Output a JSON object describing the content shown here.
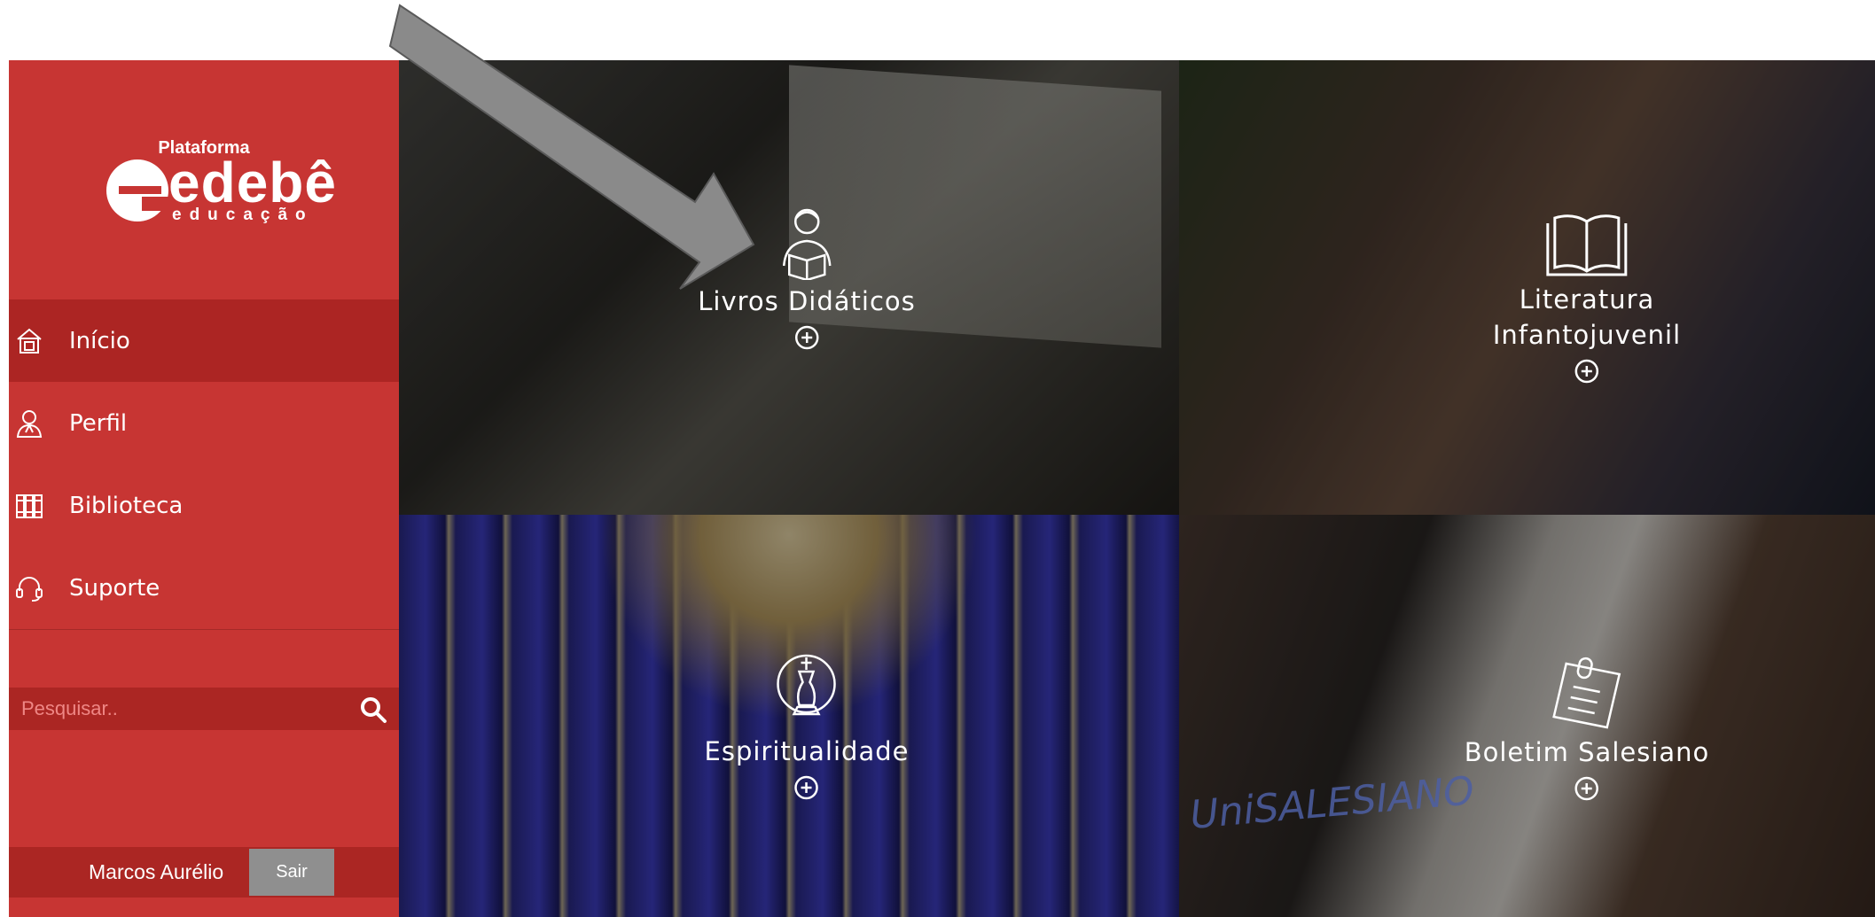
{
  "sidebar": {
    "logo": {
      "top_text": "Plataforma",
      "wordmark": "edebê",
      "tagline": "educação"
    },
    "menu": [
      {
        "label": "Início",
        "icon": "home-icon",
        "active": true
      },
      {
        "label": "Perfil",
        "icon": "user-icon",
        "active": false
      },
      {
        "label": "Biblioteca",
        "icon": "books-icon",
        "active": false
      },
      {
        "label": "Suporte",
        "icon": "headset-icon",
        "active": false
      }
    ],
    "search": {
      "placeholder": "Pesquisar..",
      "icon": "search-icon"
    },
    "footer": {
      "user_name": "Marcos Aurélio",
      "logout_label": "Sair"
    }
  },
  "tiles": [
    {
      "title": "Livros Didáticos",
      "icon": "reading-student-icon"
    },
    {
      "title_line1": "Literatura",
      "title_line2": "Infantojuvenil",
      "icon": "open-book-icon"
    },
    {
      "title": "Espiritualidade",
      "icon": "cross-icon"
    },
    {
      "title": "Boletim Salesiano",
      "icon": "newsletter-icon",
      "photo_text": "UniSALESIANO"
    }
  ],
  "colors": {
    "sidebar": "#c73533",
    "sidebar_active": "#ac2523",
    "logout_button": "#8f8f8f",
    "annotation_arrow": "#8a8a8a"
  }
}
